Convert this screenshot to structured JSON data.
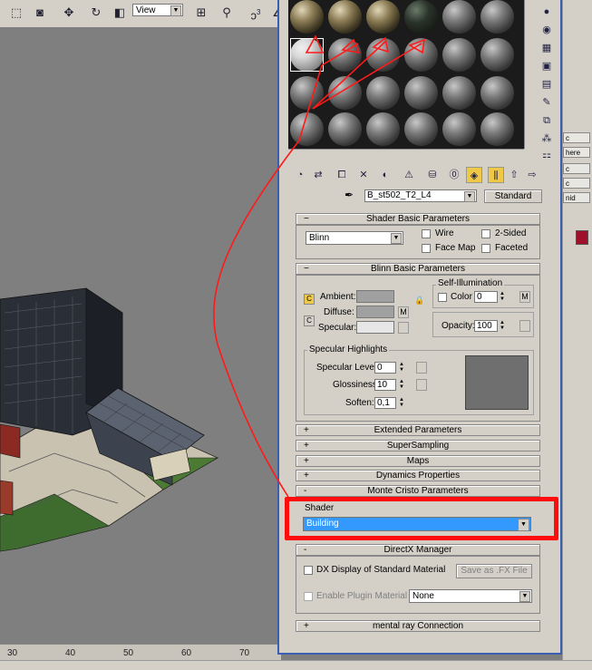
{
  "toolbar": {
    "view_label": "View",
    "snap_number": "3",
    "icons": [
      "select-region-icon",
      "window-crossing-icon",
      "move-icon",
      "rotate-icon",
      "scale-icon",
      "reference-coord-icon",
      "pivot-icon",
      "snap-icon",
      "angle-snap-icon"
    ]
  },
  "ruler": {
    "ticks": [
      "30",
      "40",
      "50",
      "60",
      "70"
    ]
  },
  "right_strip": {
    "buttons": [
      "c",
      "here",
      "c",
      "c",
      "nid",
      "c"
    ],
    "swatch_color": "#a0102a"
  },
  "material_editor": {
    "material_name": "B_st502_T2_L4",
    "type_button": "Standard",
    "rollouts": {
      "shader_basic": {
        "title": "Shader Basic Parameters",
        "shader": "Blinn",
        "wire": "Wire",
        "two_sided": "2-Sided",
        "face_map": "Face Map",
        "faceted": "Faceted"
      },
      "blinn_basic": {
        "title": "Blinn Basic Parameters",
        "ambient": "Ambient:",
        "diffuse": "Diffuse:",
        "specular": "Specular:",
        "map_button": "M",
        "self_illum_title": "Self-Illumination",
        "color_label": "Color",
        "color_value": "0",
        "opacity_label": "Opacity:",
        "opacity_value": "100",
        "spec_highlights_title": "Specular Highlights",
        "spec_level_label": "Specular Level:",
        "spec_level_value": "0",
        "glossiness_label": "Glossiness:",
        "glossiness_value": "10",
        "soften_label": "Soften:",
        "soften_value": "0,1",
        "ambient_color": "#a0a0a0",
        "diffuse_color": "#a0a0a0",
        "specular_color": "#e6e6e6"
      },
      "extended": {
        "sign": "+",
        "title": "Extended Parameters"
      },
      "supersampling": {
        "sign": "+",
        "title": "SuperSampling"
      },
      "maps": {
        "sign": "+",
        "title": "Maps"
      },
      "dynamics": {
        "sign": "+",
        "title": "Dynamics Properties"
      },
      "monte_cristo": {
        "sign": "-",
        "title": "Monte Cristo Parameters",
        "shader_label": "Shader",
        "shader_value": "Building"
      },
      "directx": {
        "sign": "-",
        "title": "DirectX Manager",
        "dx_display": "DX Display of Standard Material",
        "save_fx": "Save as .FX File",
        "enable_plugin": "Enable Plugin Material",
        "plugin_value": "None"
      },
      "mental_ray": {
        "sign": "+",
        "title": "mental ray Connection"
      }
    }
  }
}
